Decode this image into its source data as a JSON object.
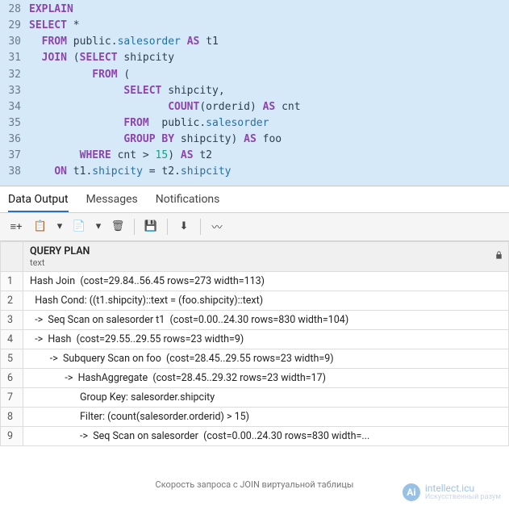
{
  "editor": {
    "lines": [
      {
        "num": 28,
        "tokens": [
          [
            "kw",
            "EXPLAIN"
          ]
        ]
      },
      {
        "num": 29,
        "tokens": [
          [
            "kw",
            "SELECT "
          ],
          [
            "op",
            "*"
          ]
        ]
      },
      {
        "num": 30,
        "tokens": [
          [
            "pad",
            "  "
          ],
          [
            "kw",
            "FROM "
          ],
          [
            "ident",
            "public"
          ],
          [
            "dot",
            "."
          ],
          [
            "field",
            "salesorder"
          ],
          [
            "kw",
            " AS "
          ],
          [
            "ident",
            "t1"
          ]
        ]
      },
      {
        "num": 31,
        "tokens": [
          [
            "pad",
            "  "
          ],
          [
            "kw",
            "JOIN "
          ],
          [
            "op",
            "("
          ],
          [
            "kw",
            "SELECT "
          ],
          [
            "ident",
            "shipcity"
          ]
        ]
      },
      {
        "num": 32,
        "tokens": [
          [
            "pad",
            "          "
          ],
          [
            "kw",
            "FROM "
          ],
          [
            "op",
            "("
          ]
        ]
      },
      {
        "num": 33,
        "tokens": [
          [
            "pad",
            "               "
          ],
          [
            "kw",
            "SELECT "
          ],
          [
            "ident",
            "shipcity"
          ],
          [
            "op",
            ","
          ]
        ]
      },
      {
        "num": 34,
        "tokens": [
          [
            "pad",
            "                      "
          ],
          [
            "kw",
            "COUNT"
          ],
          [
            "op",
            "("
          ],
          [
            "ident",
            "orderid"
          ],
          [
            "op",
            ")"
          ],
          [
            "kw",
            " AS "
          ],
          [
            "ident",
            "cnt"
          ]
        ]
      },
      {
        "num": 35,
        "tokens": [
          [
            "pad",
            "               "
          ],
          [
            "kw",
            "FROM  "
          ],
          [
            "ident",
            "public"
          ],
          [
            "dot",
            "."
          ],
          [
            "field",
            "salesorder"
          ]
        ]
      },
      {
        "num": 36,
        "tokens": [
          [
            "pad",
            "               "
          ],
          [
            "kw",
            "GROUP BY "
          ],
          [
            "ident",
            "shipcity"
          ],
          [
            "op",
            ")"
          ],
          [
            "kw",
            " AS "
          ],
          [
            "ident",
            "foo"
          ]
        ]
      },
      {
        "num": 37,
        "tokens": [
          [
            "pad",
            "        "
          ],
          [
            "kw",
            "WHERE "
          ],
          [
            "ident",
            "cnt "
          ],
          [
            "op",
            ">"
          ],
          [
            "num",
            " 15"
          ],
          [
            "op",
            ")"
          ],
          [
            "kw",
            " AS "
          ],
          [
            "ident",
            "t2"
          ]
        ]
      },
      {
        "num": 38,
        "tokens": [
          [
            "pad",
            "    "
          ],
          [
            "kw",
            "ON "
          ],
          [
            "ident",
            "t1"
          ],
          [
            "dot",
            "."
          ],
          [
            "field",
            "shipcity"
          ],
          [
            "op",
            " = "
          ],
          [
            "ident",
            "t2"
          ],
          [
            "dot",
            "."
          ],
          [
            "field",
            "shipcity"
          ]
        ]
      }
    ]
  },
  "tabs": {
    "items": [
      {
        "label": "Data Output",
        "active": true
      },
      {
        "label": "Messages",
        "active": false
      },
      {
        "label": "Notifications",
        "active": false
      }
    ]
  },
  "toolbar_icons": {
    "add_row": "≡+",
    "copy": "📋",
    "dropdown": "▾",
    "paste": "📄",
    "dropdown2": "▾",
    "delete": "🗑",
    "save": "💾",
    "download": "⬇",
    "chart": "〰"
  },
  "grid": {
    "column_header": "QUERY PLAN",
    "column_type": "text",
    "rows": [
      "Hash Join  (cost=29.84..56.45 rows=273 width=113)",
      "  Hash Cond: ((t1.shipcity)::text = (foo.shipcity)::text)",
      "  ->  Seq Scan on salesorder t1  (cost=0.00..24.30 rows=830 width=104)",
      "  ->  Hash  (cost=29.55..29.55 rows=23 width=9)",
      "        ->  Subquery Scan on foo  (cost=28.45..29.55 rows=23 width=9)",
      "              ->  HashAggregate  (cost=28.45..29.32 rows=23 width=17)",
      "                    Group Key: salesorder.shipcity",
      "                    Filter: (count(salesorder.orderid) > 15)",
      "                    ->  Seq Scan on salesorder  (cost=0.00..24.30 rows=830 width=..."
    ]
  },
  "caption": "Скорость запроса с JOIN виртуальной таблицы",
  "watermark": {
    "main": "intellect.icu",
    "sub": "Искусственный разум",
    "badge": "Ai"
  }
}
